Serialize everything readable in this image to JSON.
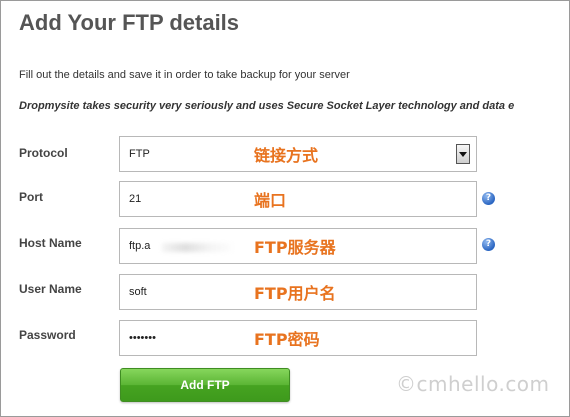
{
  "header": {
    "title": "Add Your FTP details",
    "intro": "Fill out the details and save it in order to take backup for your server",
    "security_note": "Dropmysite takes security very seriously and uses Secure Socket Layer technology and data e"
  },
  "form": {
    "protocol": {
      "label": "Protocol",
      "value": "FTP",
      "annotation": "链接方式"
    },
    "port": {
      "label": "Port",
      "value": "21",
      "annotation": "端口"
    },
    "host": {
      "label": "Host Name",
      "value": "ftp.a",
      "annotation": "FTP服务器"
    },
    "user": {
      "label": "User Name",
      "value": "soft",
      "annotation": "FTP用户名"
    },
    "password": {
      "label": "Password",
      "value": "•••••••",
      "annotation": "FTP密码"
    }
  },
  "icons": {
    "help": "?"
  },
  "actions": {
    "add_label": "Add FTP"
  },
  "watermark": "©cmhello.com",
  "colors": {
    "accent_annotation": "#e8731f",
    "button_green": "#4fae2a",
    "help_blue": "#2b66c2"
  }
}
